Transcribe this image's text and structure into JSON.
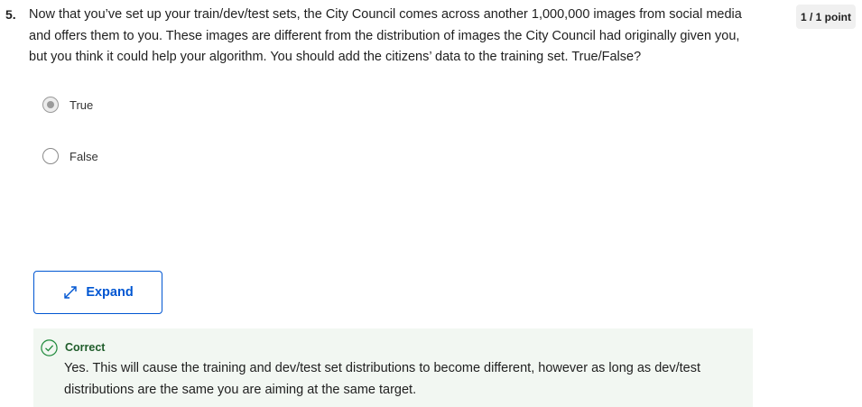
{
  "question": {
    "number": "5.",
    "text": "Now that you’ve set up your train/dev/test sets, the City Council comes across another 1,000,000 images from social media and offers them to you. These images are different from the distribution of images the City Council had originally given you, but you think it could help your algorithm. You should add the citizens’ data to the training set. True/False?",
    "points": "1 / 1 point"
  },
  "options": [
    {
      "label": "True",
      "selected": true
    },
    {
      "label": "False",
      "selected": false
    }
  ],
  "expand_button": {
    "label": "Expand",
    "icon": "expand-arrows-icon"
  },
  "feedback": {
    "status": "Correct",
    "icon": "check-circle-icon",
    "text": "Yes. This will cause the training and dev/test set distributions to become different, however as long as dev/test distributions are the same you are aiming at the same target."
  },
  "colors": {
    "accent": "#0056d2",
    "correct": "#1f8a3b",
    "feedback_bg": "#f2f7f2"
  }
}
